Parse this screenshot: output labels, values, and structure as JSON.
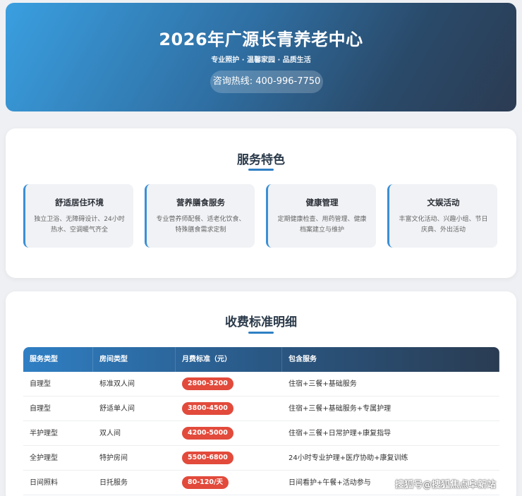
{
  "hero": {
    "title": "2026年广源长青养老中心",
    "subtitle": "专业照护 · 温馨家园 · 品质生活",
    "hotline": "咨询热线: 400-996-7750"
  },
  "services": {
    "title": "服务特色",
    "cards": [
      {
        "title": "舒适居住环境",
        "desc": "独立卫浴、无障碍设计、24小时热水、空调暖气齐全"
      },
      {
        "title": "营养膳食服务",
        "desc": "专业营养师配餐、适老化饮食、特殊膳食需求定制"
      },
      {
        "title": "健康管理",
        "desc": "定期健康检查、用药管理、健康档案建立与维护"
      },
      {
        "title": "文娱活动",
        "desc": "丰富文化活动、兴趣小组、节日庆典、外出活动"
      }
    ]
  },
  "fees": {
    "title": "收费标准明细",
    "headers": [
      "服务类型",
      "房间类型",
      "月费标准（元）",
      "包含服务"
    ],
    "rows": [
      {
        "type": "自理型",
        "room": "标准双人间",
        "price": "2800-3200",
        "includes": "住宿+三餐+基础服务"
      },
      {
        "type": "自理型",
        "room": "舒适单人间",
        "price": "3800-4500",
        "includes": "住宿+三餐+基础服务+专属护理"
      },
      {
        "type": "半护理型",
        "room": "双人间",
        "price": "4200-5000",
        "includes": "住宿+三餐+日常护理+康复指导"
      },
      {
        "type": "全护理型",
        "room": "特护房间",
        "price": "5500-6800",
        "includes": "24小时专业护理+医疗协助+康复训练"
      },
      {
        "type": "日间照料",
        "room": "日托服务",
        "price": "80-120/天",
        "includes": "日间看护+午餐+活动参与"
      }
    ]
  },
  "watermark": "搜狐号@搜狐焦点阜新站",
  "colors": {
    "accent": "#2f7fc4",
    "price_badge": "#e24a3b",
    "header_dark": "#2a3c52"
  }
}
